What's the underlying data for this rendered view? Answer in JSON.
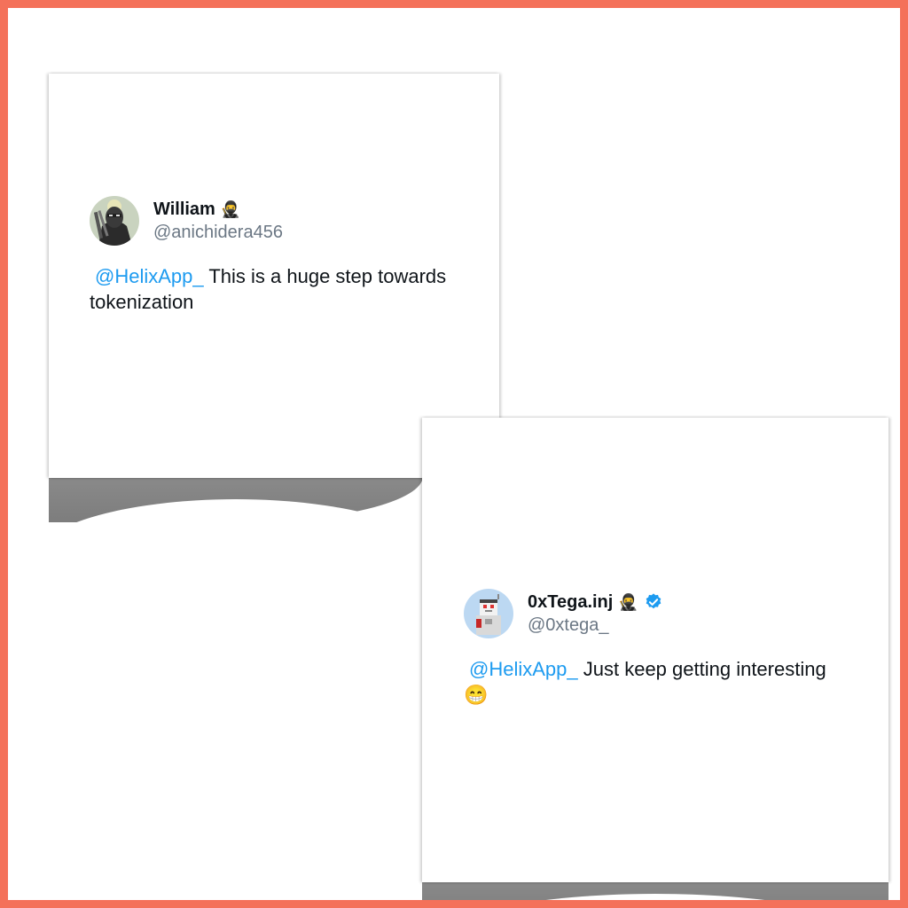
{
  "colors": {
    "frame": "#f4715a",
    "mention": "#1d9bf0",
    "verified": "#1d9bf0"
  },
  "tweets": [
    {
      "display_name": "William",
      "name_emoji": "🥷",
      "handle": "@anichidera456",
      "mention": "@HelixApp_",
      "text": "This is a huge step towards tokenization",
      "verified": false,
      "avatar_icon": "avatar-ninja-icon"
    },
    {
      "display_name": "0xTega.inj",
      "name_emoji": "🥷",
      "handle": "@0xtega_",
      "mention": "@HelixApp_",
      "text": "Just keep getting interesting",
      "trailing_emoji": "😁",
      "verified": true,
      "avatar_icon": "avatar-pixel-astronaut-icon"
    }
  ]
}
